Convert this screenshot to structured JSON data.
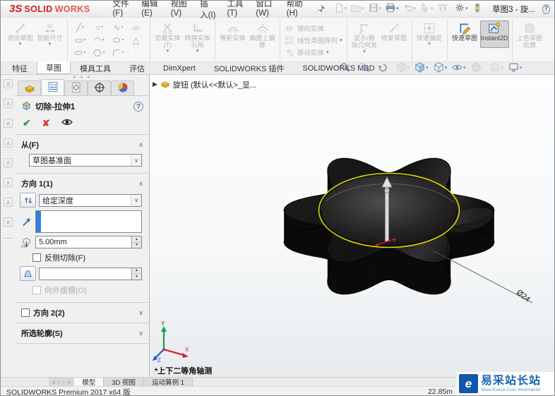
{
  "titlebar": {
    "logo_mark": "3S",
    "logo_bold": "SOLID",
    "logo_light": "WORKS",
    "menus": [
      "文件(F)",
      "编辑(E)",
      "视图(V)",
      "插入(I)",
      "工具(T)",
      "窗口(W)",
      "帮助(H)"
    ],
    "quick_icons": [
      {
        "icon": "new-doc",
        "dropdown": true,
        "enabled": false
      },
      {
        "icon": "open-doc",
        "dropdown": true,
        "enabled": false
      },
      {
        "icon": "save",
        "dropdown": true,
        "enabled": false
      },
      {
        "icon": "print",
        "dropdown": true,
        "enabled": true
      },
      {
        "icon": "undo",
        "dropdown": true,
        "enabled": false
      },
      {
        "icon": "select-pointer",
        "dropdown": true,
        "enabled": false
      },
      {
        "icon": "selection-filter",
        "dropdown": false,
        "enabled": false
      },
      {
        "icon": "options-gear",
        "dropdown": true,
        "enabled": true
      },
      {
        "icon": "rebuild",
        "dropdown": false,
        "enabled": true
      }
    ],
    "doc_title": "草图3 - 旋...",
    "help_label": "?"
  },
  "ribbon": {
    "exit_group": [
      {
        "label": "退出草图",
        "icon": "exit-sketch",
        "enabled": false,
        "dropdown": true
      },
      {
        "label": "智能尺寸",
        "icon": "smart-dimension",
        "enabled": false,
        "dropdown": true
      }
    ],
    "entity_grid": [
      {
        "icon": "line",
        "dropdown": true
      },
      {
        "icon": "circle",
        "dropdown": true
      },
      {
        "icon": "spline",
        "dropdown": true
      },
      {
        "icon": "plane",
        "dropdown": false
      },
      {
        "icon": "corner-rectangle",
        "dropdown": true
      },
      {
        "icon": "arc",
        "dropdown": true
      },
      {
        "icon": "ellipse",
        "dropdown": true
      },
      {
        "icon": "polygon-tool",
        "dropdown": false
      },
      {
        "icon": "slot",
        "dropdown": true
      },
      {
        "icon": "hexagon",
        "dropdown": true
      },
      {
        "icon": "sketch-fillet",
        "dropdown": true
      },
      {
        "icon": "point",
        "dropdown": false
      }
    ],
    "trim_group": [
      {
        "label": "剪裁实体(T)",
        "icon": "trim-entities",
        "enabled": false,
        "dropdown": true
      },
      {
        "label": "转换实体引用",
        "icon": "convert-entities",
        "enabled": false,
        "dropdown": true
      }
    ],
    "offset_group": [
      {
        "label": "等距实体",
        "icon": "offset-entities",
        "enabled": false,
        "dropdown": false
      },
      {
        "label": "曲面上偏移",
        "icon": "offset-on-surface",
        "enabled": false,
        "dropdown": false
      }
    ],
    "pattern_stack": [
      {
        "label": "镜向实体",
        "icon": "mirror-entities",
        "enabled": false,
        "dropdown": false
      },
      {
        "label": "线性草图阵列",
        "icon": "linear-sketch-pattern",
        "enabled": false,
        "dropdown": true
      },
      {
        "label": "移动实体",
        "icon": "move-entities",
        "enabled": false,
        "dropdown": true
      }
    ],
    "relations_group": [
      {
        "label": "显示/删除几何关系",
        "icon": "display-relations",
        "enabled": false,
        "dropdown": true
      },
      {
        "label": "修复草图",
        "icon": "repair-sketch",
        "enabled": false,
        "dropdown": false
      }
    ],
    "snap_group": [
      {
        "label": "快速捕捉",
        "icon": "quick-snaps",
        "enabled": false,
        "dropdown": true
      }
    ],
    "quick_group": [
      {
        "label": "快速草图",
        "icon": "rapid-sketch",
        "enabled": true,
        "dropdown": false
      },
      {
        "label": "Instant2D",
        "icon": "instant2d",
        "enabled": true,
        "active": true,
        "dropdown": false
      }
    ],
    "shaded_group": [
      {
        "label": "上色草图轮廓",
        "icon": "shaded-sketch-contours",
        "enabled": false,
        "dropdown": false
      }
    ]
  },
  "command_tabs": [
    {
      "label": "特征"
    },
    {
      "label": "草图",
      "active": true
    },
    {
      "label": "模具工具"
    },
    {
      "label": "评估"
    },
    {
      "label": "DimXpert"
    },
    {
      "label": "SOLIDWORKS 插件"
    },
    {
      "label": "SOLIDWORKS MBD"
    }
  ],
  "headsup": [
    {
      "icon": "zoom-fit",
      "enabled": true,
      "dropdown": false
    },
    {
      "icon": "zoom-area",
      "enabled": true,
      "dropdown": false
    },
    {
      "icon": "previous-view",
      "enabled": true,
      "dropdown": false
    },
    {
      "icon": "section-view",
      "enabled": false,
      "dropdown": true
    },
    {
      "icon": "view-orientation",
      "enabled": true,
      "dropdown": true
    },
    {
      "icon": "display-style",
      "enabled": true,
      "dropdown": true
    },
    {
      "icon": "hide-show-items",
      "enabled": true,
      "dropdown": true
    },
    {
      "icon": "edit-appearance",
      "enabled": false,
      "dropdown": false
    },
    {
      "icon": "apply-scene",
      "enabled": false,
      "dropdown": true
    },
    {
      "icon": "view-settings",
      "enabled": true,
      "dropdown": true
    }
  ],
  "side_toolbar": [
    "annotation-tool",
    "annotation-tool",
    "annotation-tool",
    "annotation-tool",
    "annotation-tool",
    "annotation-tool",
    "annotation-tool",
    "annotation-tool"
  ],
  "panel": {
    "tabs": [
      {
        "icon": "feature-manager"
      },
      {
        "icon": "property-manager",
        "active": true
      },
      {
        "icon": "configuration-manager"
      },
      {
        "icon": "dimxpert-manager"
      },
      {
        "icon": "display-manager"
      }
    ],
    "title": "切除-拉伸1",
    "help_label": "?",
    "from": {
      "label": "从(F)",
      "value": "草图基准面"
    },
    "direction1": {
      "label": "方向 1(1)",
      "end_condition": "给定深度",
      "depth_value": "5.00mm",
      "flip_label": "反侧切除(F)",
      "draft_out_label": "向外拔模(O)"
    },
    "direction2": {
      "label": "方向 2(2)"
    },
    "contours": {
      "label": "所选轮廓(S)"
    }
  },
  "graphics": {
    "tree_item": "旋钮 (默认<<默认>_显...",
    "view_label": "*上下二等角轴测",
    "dimension": "Ø24",
    "triad": {
      "x": "X",
      "y": "Y",
      "z": "Z"
    }
  },
  "bottom": {
    "nav": [
      "first-sheet",
      "prev-sheet",
      "next-sheet",
      "last-sheet"
    ],
    "tabs": [
      {
        "label": "模型",
        "active": true
      },
      {
        "label": "3D 视图"
      },
      {
        "label": "运动算例 1"
      }
    ]
  },
  "statusbar": {
    "left": "SOLIDWORKS Premium 2017 x64 版",
    "measure": "22.85m"
  },
  "watermark": {
    "logo_letter": "e",
    "brand": "易采站长站",
    "url_line": "Www.Easck.Com Webmaster"
  },
  "colors": {
    "sketch_yellow": "#d6d600",
    "model_black": "#0b0b0b",
    "selection_blue": "#2f7fe0",
    "ok_green": "#2f9e3f",
    "cancel_red": "#d03a2b",
    "logo_red": "#d71920",
    "watermark_blue": "#1b64b5",
    "triad_x": "#cc2222",
    "triad_y": "#15a04a",
    "triad_z": "#2255cc"
  }
}
